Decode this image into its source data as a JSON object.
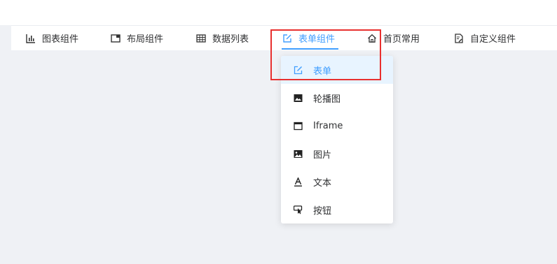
{
  "menu": {
    "items": [
      {
        "label": "图表组件",
        "icon": "bar-chart-icon"
      },
      {
        "label": "布局组件",
        "icon": "layout-icon"
      },
      {
        "label": "数据列表",
        "icon": "table-icon"
      },
      {
        "label": "表单组件",
        "icon": "edit-icon",
        "active": true
      },
      {
        "label": "首页常用",
        "icon": "home-icon"
      },
      {
        "label": "自定义组件",
        "icon": "custom-doc-icon"
      }
    ]
  },
  "dropdown": {
    "items": [
      {
        "label": "表单",
        "icon": "edit-icon",
        "active": true
      },
      {
        "label": "轮播图",
        "icon": "image-icon"
      },
      {
        "label": "Iframe",
        "icon": "window-icon"
      },
      {
        "label": "图片",
        "icon": "picture-icon"
      },
      {
        "label": "文本",
        "icon": "text-icon"
      },
      {
        "label": "按钮",
        "icon": "button-click-icon"
      }
    ]
  },
  "colors": {
    "accent": "#409eff",
    "highlight": "#e8302f",
    "background": "#eff1f5",
    "active_bg": "#e8f4ff"
  }
}
